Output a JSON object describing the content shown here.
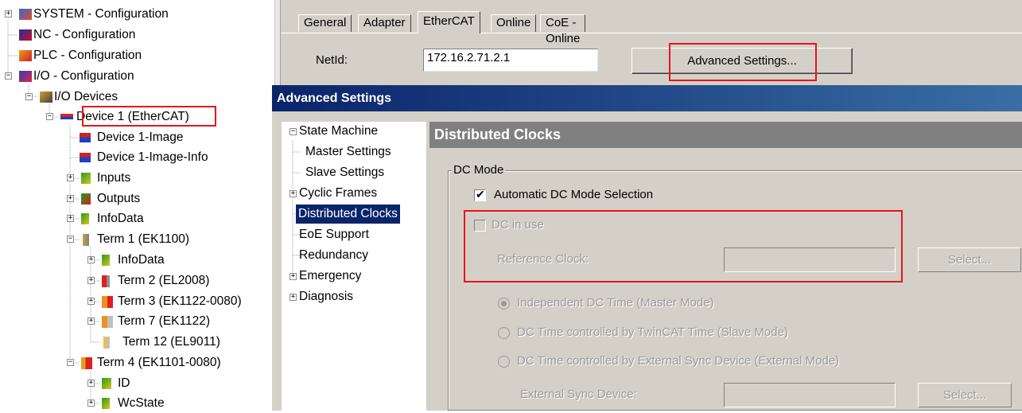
{
  "tree": {
    "items": [
      {
        "label": "SYSTEM - Configuration",
        "icon": "system-config-icon"
      },
      {
        "label": "NC - Configuration",
        "icon": "nc-config-icon"
      },
      {
        "label": "PLC - Configuration",
        "icon": "plc-config-icon"
      },
      {
        "label": "I/O - Configuration",
        "icon": "io-config-icon"
      },
      {
        "label": "I/O Devices",
        "icon": "io-devices-icon"
      },
      {
        "label": "Device 1 (EtherCAT)",
        "icon": "ethercat-device-icon"
      },
      {
        "label": "Device 1-Image",
        "icon": "image-icon"
      },
      {
        "label": "Device 1-Image-Info",
        "icon": "image-info-icon"
      },
      {
        "label": "Inputs",
        "icon": "inputs-icon"
      },
      {
        "label": "Outputs",
        "icon": "outputs-icon"
      },
      {
        "label": "InfoData",
        "icon": "infodata-icon"
      },
      {
        "label": "Term 1 (EK1100)",
        "icon": "terminal-icon"
      },
      {
        "label": "InfoData",
        "icon": "infodata-icon"
      },
      {
        "label": "Term 2 (EL2008)",
        "icon": "terminal-red-icon"
      },
      {
        "label": "Term 3 (EK1122-0080)",
        "icon": "terminal-orange-icon"
      },
      {
        "label": "Term 7 (EK1122)",
        "icon": "terminal-orange-icon"
      },
      {
        "label": "Term 12 (EL9011)",
        "icon": "terminal-end-icon"
      },
      {
        "label": "Term 4 (EK1101-0080)",
        "icon": "terminal-coupler-icon"
      },
      {
        "label": "ID",
        "icon": "id-icon"
      },
      {
        "label": "WcState",
        "icon": "wcstate-icon"
      }
    ]
  },
  "tabs": [
    "General",
    "Adapter",
    "EtherCAT",
    "Online",
    "CoE - Online"
  ],
  "active_tab": "EtherCAT",
  "netid": {
    "label": "NetId:",
    "value": "172.16.2.71.2.1"
  },
  "advanced_button": "Advanced Settings...",
  "dialog": {
    "title": "Advanced Settings",
    "nav": [
      {
        "label": "State Machine"
      },
      {
        "label": "Master Settings"
      },
      {
        "label": "Slave Settings"
      },
      {
        "label": "Cyclic Frames"
      },
      {
        "label": "Distributed Clocks"
      },
      {
        "label": "EoE Support"
      },
      {
        "label": "Redundancy"
      },
      {
        "label": "Emergency"
      },
      {
        "label": "Diagnosis"
      }
    ],
    "selected_nav": "Distributed Clocks",
    "header": "Distributed Clocks",
    "group_title": "DC Mode",
    "auto_dc_label": "Automatic DC Mode Selection",
    "dc_in_use_label": "DC in use",
    "reference_clock_label": "Reference Clock:",
    "reference_clock_value": "",
    "select_label": "Select...",
    "radio_independent": "Independent DC Time (Master Mode)",
    "radio_twincat": "DC Time controlled by TwinCAT Time (Slave Mode)",
    "radio_external": "DC Time controlled by External Sync Device (External Mode)",
    "external_sync_label": "External Sync Device:",
    "external_sync_value": "",
    "select2_label": "Select..."
  },
  "colors": {
    "highlight_box": "#e8141c",
    "title_bar": "#0a246a",
    "header_bar": "#808080"
  }
}
